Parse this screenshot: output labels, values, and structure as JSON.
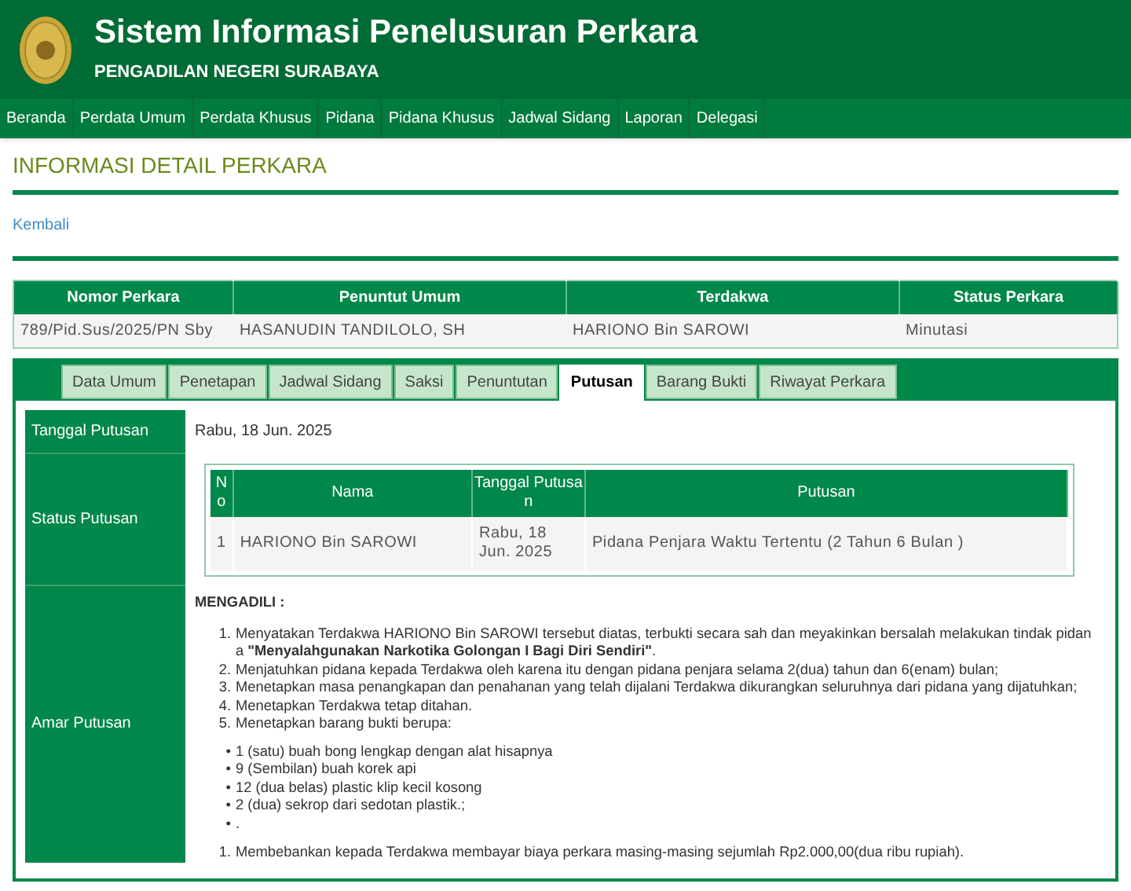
{
  "header": {
    "title": "Sistem Informasi Penelusuran Perkara",
    "subtitle": "PENGADILAN NEGERI SURABAYA"
  },
  "nav": [
    "Beranda",
    "Perdata Umum",
    "Perdata Khusus",
    "Pidana",
    "Pidana Khusus",
    "Jadwal Sidang",
    "Laporan",
    "Delegasi"
  ],
  "page_title": "INFORMASI DETAIL PERKARA",
  "back_link": "Kembali",
  "case_table": {
    "columns": [
      "Nomor Perkara",
      "Penuntut Umum",
      "Terdakwa",
      "Status Perkara"
    ],
    "rows": [
      [
        "789/Pid.Sus/2025/PN Sby",
        "HASANUDIN TANDILOLO, SH",
        "HARIONO Bin SAROWI",
        "Minutasi"
      ]
    ]
  },
  "tabs": [
    {
      "label": "Data Umum",
      "selected": false
    },
    {
      "label": "Penetapan",
      "selected": false
    },
    {
      "label": "Jadwal Sidang",
      "selected": false
    },
    {
      "label": "Saksi",
      "selected": false
    },
    {
      "label": "Penuntutan",
      "selected": false
    },
    {
      "label": "Putusan",
      "selected": true
    },
    {
      "label": "Barang Bukti",
      "selected": false
    },
    {
      "label": "Riwayat Perkara",
      "selected": false
    }
  ],
  "decision": {
    "date_label": "Tanggal Putusan",
    "date": "Rabu, 18 Jun. 2025",
    "status_label": "Status Putusan",
    "status_table": {
      "columns": [
        "No",
        "Nama",
        "Tanggal Putusan",
        "Putusan"
      ],
      "rows": [
        [
          "1",
          "HARIONO Bin SAROWI",
          "Rabu, 18 Jun. 2025",
          "Pidana Penjara Waktu Tertentu (2 Tahun 6 Bulan )"
        ]
      ]
    },
    "verdict_label": "Amar Putusan",
    "verdict": {
      "heading": "MENGADILI :",
      "items": [
        {
          "marker": "1.",
          "text": "Menyatakan Terdakwa HARIONO Bin SAROWI tersebut diatas, terbukti secara sah dan meyakinkan bersalah melakukan tindak pidana **\"Menyalahgunakan Narkotika Golongan I Bagi Diri Sendiri\"**."
        },
        {
          "marker": "2.",
          "text": "Menjatuhkan pidana kepada Terdakwa oleh karena itu dengan pidana penjara selama 2(dua) tahun dan 6(enam) bulan;"
        },
        {
          "marker": "3.",
          "text": "Menetapkan masa penangkapan dan penahanan yang telah dijalani Terdakwa dikurangkan seluruhnya dari pidana yang dijatuhkan;"
        },
        {
          "marker": "4.",
          "text": "Menetapkan Terdakwa tetap ditahan."
        },
        {
          "marker": "5.",
          "text": "Menetapkan barang bukti berupa:"
        }
      ],
      "evidence": [
        {
          "marker": "•",
          "text": "1 (satu) buah bong lengkap dengan alat hisapnya"
        },
        {
          "marker": "•",
          "text": "9 (Sembilan) buah korek api"
        },
        {
          "marker": "•",
          "text": "12 (dua belas) plastic klip kecil kosong"
        },
        {
          "marker": "•",
          "text": "2 (dua) sekrop dari sedotan plastik.;"
        },
        {
          "marker": "•",
          "text": "."
        }
      ],
      "closing": [
        {
          "marker": "1.",
          "text": "Membebankan kepada Terdakwa membayar biaya perkara masing-masing sejumlah Rp2.000,00(dua ribu rupiah)."
        }
      ]
    }
  }
}
